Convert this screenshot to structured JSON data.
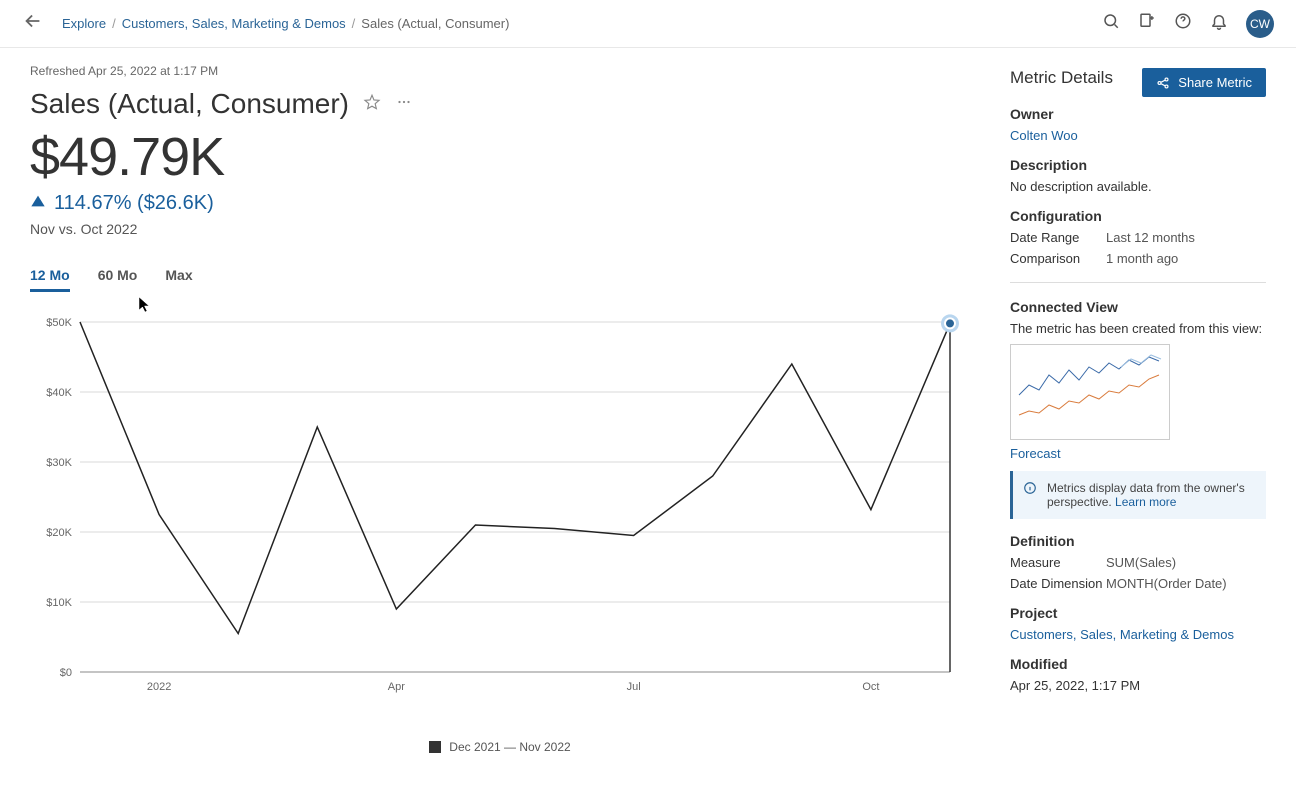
{
  "breadcrumb": {
    "root": "Explore",
    "parent": "Customers, Sales, Marketing & Demos",
    "current": "Sales (Actual, Consumer)"
  },
  "user": {
    "initials": "CW"
  },
  "refreshed": "Refreshed Apr 25, 2022 at 1:17 PM",
  "page_title": "Sales (Actual, Consumer)",
  "share_button": "Share Metric",
  "big_value": "$49.79K",
  "change": {
    "text": "114.67% ($26.6K)"
  },
  "compare": "Nov vs. Oct 2022",
  "tabs": {
    "t12": "12 Mo",
    "t60": "60 Mo",
    "tmax": "Max"
  },
  "legend": {
    "label": "Dec 2021 — Nov 2022"
  },
  "details": {
    "title": "Metric Details",
    "owner_h": "Owner",
    "owner_v": "Colten Woo",
    "desc_h": "Description",
    "desc_v": "No description available.",
    "config_h": "Configuration",
    "date_range_k": "Date Range",
    "date_range_v": "Last 12 months",
    "comparison_k": "Comparison",
    "comparison_v": "1 month ago",
    "connected_h": "Connected View",
    "connected_v": "The metric has been created from this view:",
    "connected_link": "Forecast",
    "callout_text": "Metrics display data from the owner's perspective. ",
    "callout_learn": "Learn more",
    "definition_h": "Definition",
    "measure_k": "Measure",
    "measure_v": "SUM(Sales)",
    "date_dim_k": "Date Dimension",
    "date_dim_v": "MONTH(Order Date)",
    "project_h": "Project",
    "project_v": "Customers, Sales, Marketing & Demos",
    "modified_h": "Modified",
    "modified_v": "Apr 25, 2022, 1:17 PM"
  },
  "chart_data": {
    "type": "line",
    "title": "Sales (Actual, Consumer)",
    "xlabel": "",
    "ylabel": "",
    "ylim": [
      0,
      50000
    ],
    "y_ticks": [
      "$0",
      "$10K",
      "$20K",
      "$30K",
      "$40K",
      "$50K"
    ],
    "x_ticks": [
      "2022",
      "Apr",
      "Jul",
      "Oct"
    ],
    "categories": [
      "Dec 2021",
      "Jan 2022",
      "Feb 2022",
      "Mar 2022",
      "Apr 2022",
      "May 2022",
      "Jun 2022",
      "Jul 2022",
      "Aug 2022",
      "Sep 2022",
      "Oct 2022",
      "Nov 2022"
    ],
    "series": [
      {
        "name": "Dec 2021 — Nov 2022",
        "values": [
          50000,
          22500,
          5500,
          35000,
          9000,
          21000,
          20500,
          19500,
          28000,
          44000,
          23200,
          49800
        ]
      }
    ]
  }
}
